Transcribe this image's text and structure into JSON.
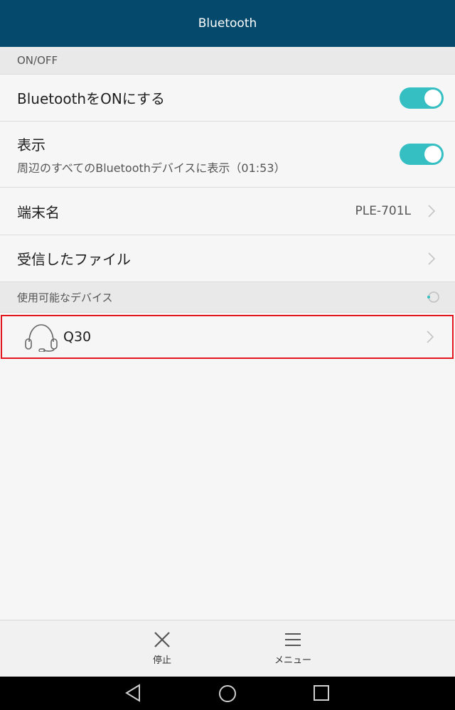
{
  "header": {
    "title": "Bluetooth"
  },
  "sections": {
    "onoff": "ON/OFF",
    "available": "使用可能なデバイス"
  },
  "settings": {
    "bluetooth_on": {
      "label": "BluetoothをONにする",
      "state": "on"
    },
    "visibility": {
      "label": "表示",
      "sublabel": "周辺のすべてのBluetoothデバイスに表示（01:53）",
      "state": "on"
    },
    "device_name": {
      "label": "端末名",
      "value": "PLE-701L"
    },
    "received_files": {
      "label": "受信したファイル"
    }
  },
  "devices": [
    {
      "name": "Q30",
      "icon": "headset-icon"
    }
  ],
  "bottom_bar": {
    "stop_label": "停止",
    "menu_label": "メニュー"
  },
  "colors": {
    "header_bg": "#054a6c",
    "toggle_on": "#35bfc3",
    "highlight_border": "#e2161c"
  }
}
